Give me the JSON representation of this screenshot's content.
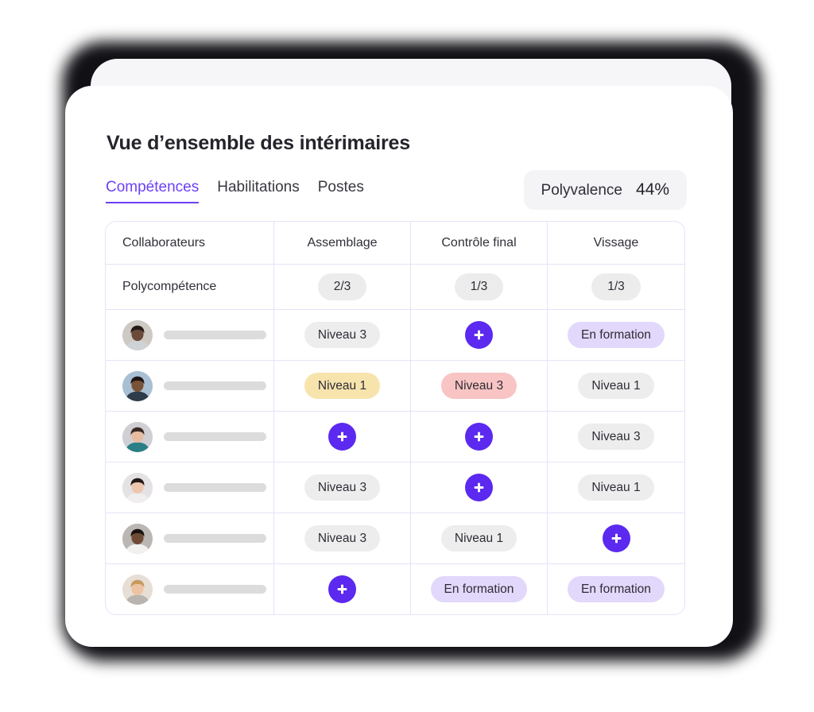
{
  "header": {
    "title": "Vue d’ensemble des intérimaires",
    "tabs": [
      {
        "label": "Compétences",
        "active": true
      },
      {
        "label": "Habilitations",
        "active": false
      },
      {
        "label": "Postes",
        "active": false
      }
    ],
    "kpi": {
      "label": "Polyvalence",
      "value": "44%"
    }
  },
  "table": {
    "columns": [
      "Collaborateurs",
      "Assemblage",
      "Contrôle final",
      "Vissage"
    ],
    "summary": {
      "label": "Polycompétence",
      "values": [
        "2/3",
        "1/3",
        "1/3"
      ]
    },
    "rows": [
      {
        "avatar": "avatar-person-1",
        "name_redacted": true,
        "cells": [
          {
            "type": "pill",
            "label": "Niveau 3",
            "tone": "gray"
          },
          {
            "type": "add",
            "label": "+"
          },
          {
            "type": "pill",
            "label": "En formation",
            "tone": "purple"
          }
        ]
      },
      {
        "avatar": "avatar-person-2",
        "name_redacted": true,
        "cells": [
          {
            "type": "pill",
            "label": "Niveau 1",
            "tone": "yellow"
          },
          {
            "type": "pill",
            "label": "Niveau 3",
            "tone": "red"
          },
          {
            "type": "pill",
            "label": "Niveau 1",
            "tone": "gray"
          }
        ]
      },
      {
        "avatar": "avatar-person-3",
        "name_redacted": true,
        "cells": [
          {
            "type": "add",
            "label": "+"
          },
          {
            "type": "add",
            "label": "+"
          },
          {
            "type": "pill",
            "label": "Niveau 3",
            "tone": "gray"
          }
        ]
      },
      {
        "avatar": "avatar-person-4",
        "name_redacted": true,
        "cells": [
          {
            "type": "pill",
            "label": "Niveau 3",
            "tone": "gray"
          },
          {
            "type": "add",
            "label": "+"
          },
          {
            "type": "pill",
            "label": "Niveau 1",
            "tone": "gray"
          }
        ]
      },
      {
        "avatar": "avatar-person-5",
        "name_redacted": true,
        "cells": [
          {
            "type": "pill",
            "label": "Niveau 3",
            "tone": "gray"
          },
          {
            "type": "pill",
            "label": "Niveau 1",
            "tone": "gray"
          },
          {
            "type": "add",
            "label": "+"
          }
        ]
      },
      {
        "avatar": "avatar-person-6",
        "name_redacted": true,
        "cells": [
          {
            "type": "add",
            "label": "+"
          },
          {
            "type": "pill",
            "label": "En formation",
            "tone": "purple"
          },
          {
            "type": "pill",
            "label": "En formation",
            "tone": "purple"
          }
        ]
      }
    ]
  },
  "colors": {
    "accent_purple": "#6c41f5",
    "add_button": "#5b29ef",
    "pill_gray": "#ededed",
    "pill_yellow": "#f7e4ad",
    "pill_red": "#f8c4c4",
    "pill_purple": "#e2d8fb",
    "grid_line": "#e7e2f8",
    "card_back": "#f6f6f8",
    "chip_bg": "#f4f4f6"
  }
}
